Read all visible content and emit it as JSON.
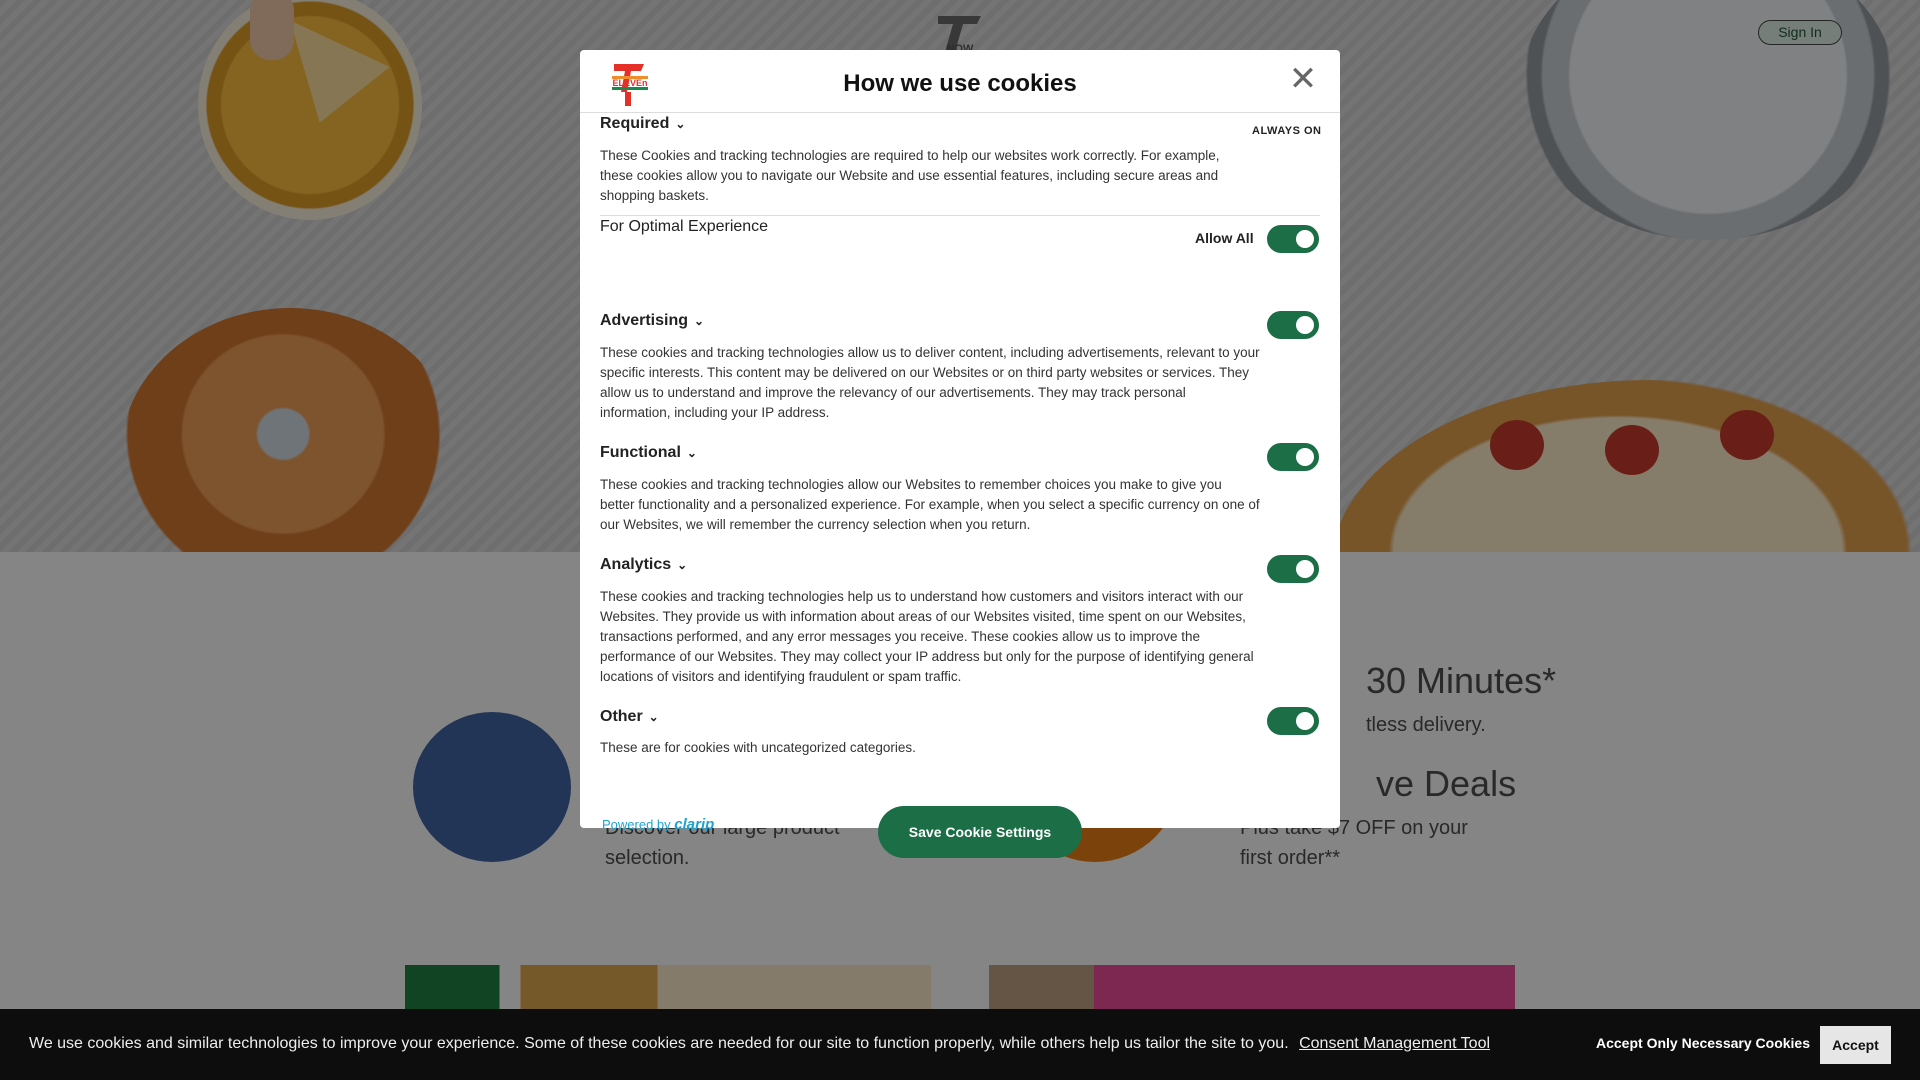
{
  "header": {
    "signin_label": "Sign In"
  },
  "features": {
    "delivery_heading": "30 Minutes*",
    "delivery_text": "tless delivery.",
    "deals_heading": "ve Deals",
    "deals_text_1": "Plus take $7 OFF on your",
    "deals_text_2": "first order**",
    "selection_text_1": "Discover our large product",
    "selection_text_2": "selection."
  },
  "modal": {
    "title": "How we use cookies",
    "close_icon": "close-icon",
    "sections": {
      "required": {
        "title": "Required",
        "status": "ALWAYS ON",
        "desc": "These Cookies and tracking technologies are required to help our websites work correctly. For example, these cookies allow you to navigate our Website and use essential features, including secure areas and shopping baskets."
      },
      "optimal": {
        "title": "For Optimal Experience",
        "allow_all_label": "Allow All",
        "allow_all_enabled": true
      },
      "advertising": {
        "title": "Advertising",
        "enabled": true,
        "desc": "These cookies and tracking technologies allow us to deliver content, including advertisements, relevant to your specific interests. This content may be delivered on our Websites or on third party websites or services. They allow us to understand and improve the relevancy of our advertisements. They may track personal information, including your IP address."
      },
      "functional": {
        "title": "Functional",
        "enabled": true,
        "desc": "These cookies and tracking technologies allow our Websites to remember choices you make to give you better functionality and a personalized experience. For example, when you select a specific currency on one of our Websites, we will remember the currency selection when you return."
      },
      "analytics": {
        "title": "Analytics",
        "enabled": true,
        "desc": "These cookies and tracking technologies help us to understand how customers and visitors interact with our Websites. They provide us with information about areas of our Websites visited, time spent on our Websites, transactions performed, and any error messages you receive. These cookies allow us to improve the performance of our Websites. They may collect your IP address but only for the purpose of identifying general locations of visitors and identifying fraudulent or spam traffic."
      },
      "other": {
        "title": "Other",
        "enabled": true,
        "desc": "These are for cookies with uncategorized categories."
      }
    },
    "powered_by": "Powered by",
    "powered_brand": "clarip",
    "save_label": "Save Cookie Settings"
  },
  "banner": {
    "text": "We use cookies and similar technologies to improve your experience. Some of these cookies are needed for our site to function properly, while others help us tailor the site to you.",
    "link_label": "Consent Management Tool",
    "necessary_label": "Accept Only Necessary Cookies",
    "accept_label": "Accept"
  },
  "colors": {
    "toggle_on": "#1b6e46",
    "save_button": "#1b6e46",
    "banner_bg": "#0d0d0d"
  }
}
